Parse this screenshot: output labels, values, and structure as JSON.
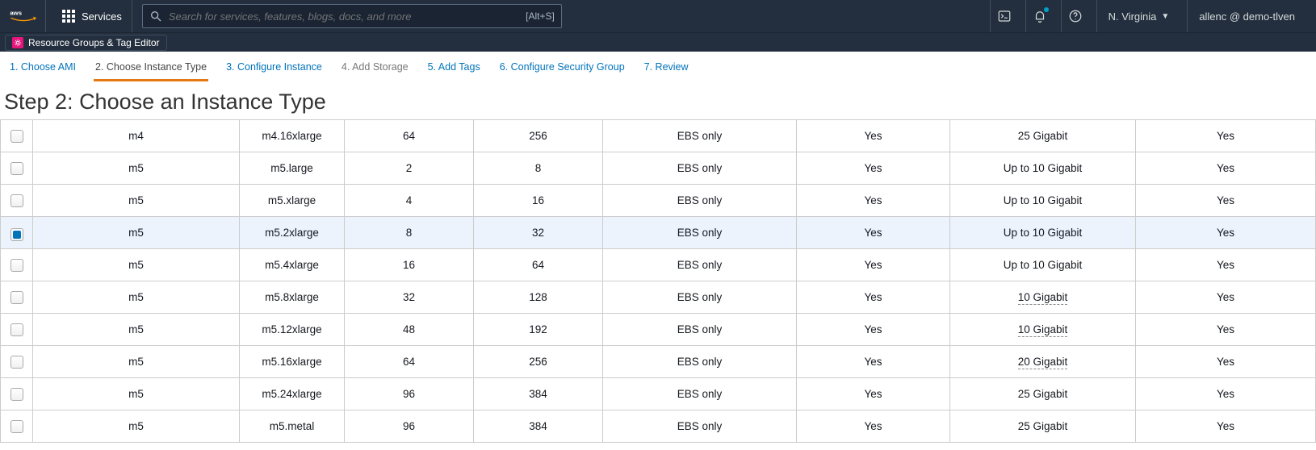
{
  "header": {
    "services_label": "Services",
    "search_placeholder": "Search for services, features, blogs, docs, and more",
    "search_shortcut": "[Alt+S]",
    "region": "N. Virginia",
    "user": "allenc @ demo-tlven"
  },
  "subnav": {
    "resource_groups_label": "Resource Groups & Tag Editor"
  },
  "wizard_steps": [
    {
      "label": "1. Choose AMI",
      "state": "link"
    },
    {
      "label": "2. Choose Instance Type",
      "state": "current"
    },
    {
      "label": "3. Configure Instance",
      "state": "link"
    },
    {
      "label": "4. Add Storage",
      "state": "disabled"
    },
    {
      "label": "5. Add Tags",
      "state": "link"
    },
    {
      "label": "6. Configure Security Group",
      "state": "link"
    },
    {
      "label": "7. Review",
      "state": "link"
    }
  ],
  "page_title": "Step 2: Choose an Instance Type",
  "instance_rows": [
    {
      "selected": false,
      "family": "m4",
      "type": "m4.16xlarge",
      "vcpus": "64",
      "memory": "256",
      "storage": "EBS only",
      "ebs_optimized": "Yes",
      "network": "25 Gigabit",
      "net_dotted": false,
      "ipv6": "Yes"
    },
    {
      "selected": false,
      "family": "m5",
      "type": "m5.large",
      "vcpus": "2",
      "memory": "8",
      "storage": "EBS only",
      "ebs_optimized": "Yes",
      "network": "Up to 10 Gigabit",
      "net_dotted": false,
      "ipv6": "Yes"
    },
    {
      "selected": false,
      "family": "m5",
      "type": "m5.xlarge",
      "vcpus": "4",
      "memory": "16",
      "storage": "EBS only",
      "ebs_optimized": "Yes",
      "network": "Up to 10 Gigabit",
      "net_dotted": false,
      "ipv6": "Yes"
    },
    {
      "selected": true,
      "family": "m5",
      "type": "m5.2xlarge",
      "vcpus": "8",
      "memory": "32",
      "storage": "EBS only",
      "ebs_optimized": "Yes",
      "network": "Up to 10 Gigabit",
      "net_dotted": false,
      "ipv6": "Yes"
    },
    {
      "selected": false,
      "family": "m5",
      "type": "m5.4xlarge",
      "vcpus": "16",
      "memory": "64",
      "storage": "EBS only",
      "ebs_optimized": "Yes",
      "network": "Up to 10 Gigabit",
      "net_dotted": false,
      "ipv6": "Yes"
    },
    {
      "selected": false,
      "family": "m5",
      "type": "m5.8xlarge",
      "vcpus": "32",
      "memory": "128",
      "storage": "EBS only",
      "ebs_optimized": "Yes",
      "network": "10 Gigabit",
      "net_dotted": true,
      "ipv6": "Yes"
    },
    {
      "selected": false,
      "family": "m5",
      "type": "m5.12xlarge",
      "vcpus": "48",
      "memory": "192",
      "storage": "EBS only",
      "ebs_optimized": "Yes",
      "network": "10 Gigabit",
      "net_dotted": true,
      "ipv6": "Yes"
    },
    {
      "selected": false,
      "family": "m5",
      "type": "m5.16xlarge",
      "vcpus": "64",
      "memory": "256",
      "storage": "EBS only",
      "ebs_optimized": "Yes",
      "network": "20 Gigabit",
      "net_dotted": true,
      "ipv6": "Yes"
    },
    {
      "selected": false,
      "family": "m5",
      "type": "m5.24xlarge",
      "vcpus": "96",
      "memory": "384",
      "storage": "EBS only",
      "ebs_optimized": "Yes",
      "network": "25 Gigabit",
      "net_dotted": false,
      "ipv6": "Yes"
    },
    {
      "selected": false,
      "family": "m5",
      "type": "m5.metal",
      "vcpus": "96",
      "memory": "384",
      "storage": "EBS only",
      "ebs_optimized": "Yes",
      "network": "25 Gigabit",
      "net_dotted": false,
      "ipv6": "Yes"
    }
  ]
}
